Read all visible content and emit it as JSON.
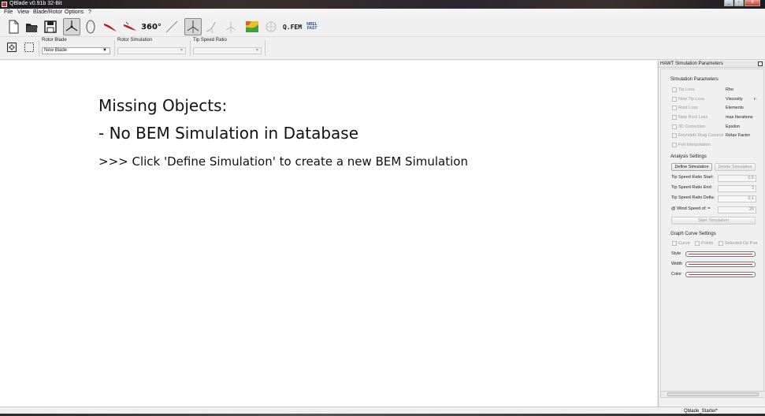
{
  "window": {
    "title": "QBlade v0.91b 32-Bit",
    "min": "_",
    "max": "▫",
    "close": "x"
  },
  "menu": [
    "File",
    "View",
    "Blade/Rotor",
    "Options",
    "?"
  ],
  "toolbar": {
    "label_360": "360°",
    "label_qfem": "Q.FEM",
    "label_nrel_top": "NREL",
    "label_nrel_bottom": "FAST"
  },
  "selectors": {
    "rotor_blade": {
      "label": "Rotor Blade",
      "value": "New Blade"
    },
    "rotor_simulation": {
      "label": "Rotor Simulation",
      "value": ""
    },
    "tip_speed_ratio": {
      "label": "Tip Speed Ratio",
      "value": ""
    }
  },
  "canvas": {
    "line1": "Missing Objects:",
    "line2": "- No BEM Simulation in Database",
    "line3": ">>> Click 'Define Simulation' to create a new BEM Simulation"
  },
  "dock": {
    "title": "HAWT Simulation Parameters",
    "simulation_parameters": {
      "heading": "Simulation Parameters",
      "checkboxes": [
        "Tip Loss",
        "New Tip Loss",
        "Root Loss",
        "New Root Loss",
        "3D Correction",
        "Reynolds Drag Correcti",
        "Foil Interpolation"
      ],
      "params": [
        "Rho",
        "Viscosity",
        "Elements",
        "max Iterations",
        "Epsilon",
        "Relax Factor"
      ],
      "viscosity_suffix": "r-"
    },
    "analysis_settings": {
      "heading": "Analysis Settings",
      "define_btn": "Define Simulation",
      "delete_btn": "Delete Simulation",
      "fields": [
        {
          "label": "Tip Speed Ratio Start:",
          "value": "0.5"
        },
        {
          "label": "Tip Speed Ratio End:",
          "value": "3"
        },
        {
          "label": "Tip Speed Ratio Delta:",
          "value": "0.1"
        },
        {
          "label": "@ Wind Speed of: =",
          "value": "20"
        }
      ],
      "start_btn": "Start Simulation"
    },
    "graph_curve": {
      "heading": "Graph Curve Settings",
      "curve": "Curve",
      "points": "Points",
      "selected": "Selected Op Poir",
      "style": "Style",
      "width": "Width",
      "color": "Color",
      "curve_color": "#d03030"
    }
  },
  "status": {
    "project": "Qblade_Starter*"
  }
}
